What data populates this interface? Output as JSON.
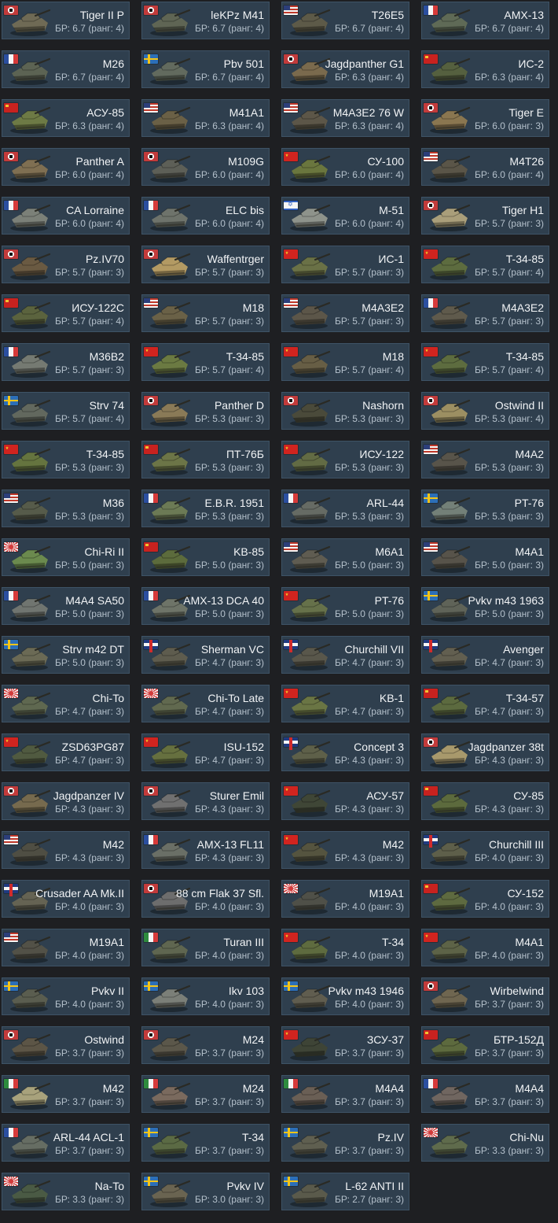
{
  "palette": {
    "background": "#1e1f22",
    "card_bg": "#2f3f4e",
    "name_color": "#f1f3f5",
    "br_color": "#b4c0cb"
  },
  "vehicles": [
    {
      "name": "Tiger II P",
      "br": "БР: 6.7 (ранг: 4)",
      "flag": "de",
      "tank": "#6f6a55"
    },
    {
      "name": "leKPz M41",
      "br": "БР: 6.7 (ранг: 4)",
      "flag": "de",
      "tank": "#5f6554"
    },
    {
      "name": "T26E5",
      "br": "БР: 6.7 (ранг: 4)",
      "flag": "us",
      "tank": "#5d5a48"
    },
    {
      "name": "AMX-13",
      "br": "БР: 6.7 (ранг: 4)",
      "flag": "fr",
      "tank": "#5f6a56"
    },
    {
      "name": "M26",
      "br": "БР: 6.7 (ранг: 4)",
      "flag": "fr",
      "tank": "#5c6353"
    },
    {
      "name": "Pbv 501",
      "br": "БР: 6.7 (ранг: 4)",
      "flag": "se",
      "tank": "#626a5e"
    },
    {
      "name": "Jagdpanther G1",
      "br": "БР: 6.3 (ранг: 4)",
      "flag": "de",
      "tank": "#7a6a4d"
    },
    {
      "name": "ИС-2",
      "br": "БР: 6.3 (ранг: 4)",
      "flag": "su",
      "tank": "#55603f"
    },
    {
      "name": "АСУ-85",
      "br": "БР: 6.3 (ранг: 4)",
      "flag": "su",
      "tank": "#6d7a45"
    },
    {
      "name": "M41A1",
      "br": "БР: 6.3 (ранг: 4)",
      "flag": "us",
      "tank": "#6a6046"
    },
    {
      "name": "M4A3E2 76 W",
      "br": "БР: 6.3 (ранг: 4)",
      "flag": "us",
      "tank": "#5c5648"
    },
    {
      "name": "Tiger E",
      "br": "БР: 6.0 (ранг: 3)",
      "flag": "de",
      "tank": "#8a7650"
    },
    {
      "name": "Panther A",
      "br": "БР: 6.0 (ранг: 4)",
      "flag": "de",
      "tank": "#7f6f52"
    },
    {
      "name": "M109G",
      "br": "БР: 6.0 (ранг: 4)",
      "flag": "de",
      "tank": "#5d5f57"
    },
    {
      "name": "СУ-100",
      "br": "БР: 6.0 (ранг: 4)",
      "flag": "cn",
      "tank": "#6a763e"
    },
    {
      "name": "M4T26",
      "br": "БР: 6.0 (ранг: 4)",
      "flag": "us",
      "tank": "#5a5548"
    },
    {
      "name": "CA Lorraine",
      "br": "БР: 6.0 (ранг: 4)",
      "flag": "fr",
      "tank": "#7b8078"
    },
    {
      "name": "ELC bis",
      "br": "БР: 6.0 (ранг: 4)",
      "flag": "fr",
      "tank": "#6e736b"
    },
    {
      "name": "M-51",
      "br": "БР: 6.0 (ранг: 4)",
      "flag": "il",
      "tank": "#8e938b"
    },
    {
      "name": "Tiger H1",
      "br": "БР: 5.7 (ранг: 3)",
      "flag": "de",
      "tank": "#a99e7a"
    },
    {
      "name": "Pz.IV70",
      "br": "БР: 5.7 (ранг: 3)",
      "flag": "de",
      "tank": "#6a5a42"
    },
    {
      "name": "Waffentrger",
      "br": "БР: 5.7 (ранг: 3)",
      "flag": "de",
      "tank": "#b39a63"
    },
    {
      "name": "ИС-1",
      "br": "БР: 5.7 (ранг: 3)",
      "flag": "cn",
      "tank": "#6a7146"
    },
    {
      "name": "T-34-85",
      "br": "БР: 5.7 (ранг: 4)",
      "flag": "cn",
      "tank": "#5d6c3f"
    },
    {
      "name": "ИСУ-122С",
      "br": "БР: 5.7 (ранг: 4)",
      "flag": "su",
      "tank": "#5b633e"
    },
    {
      "name": "M18",
      "br": "БР: 5.7 (ранг: 3)",
      "flag": "us",
      "tank": "#6a6147"
    },
    {
      "name": "M4A3E2",
      "br": "БР: 5.7 (ранг: 3)",
      "flag": "us",
      "tank": "#5c5649"
    },
    {
      "name": "M4A3E2",
      "br": "БР: 5.7 (ранг: 3)",
      "flag": "fr",
      "tank": "#5f5a4c"
    },
    {
      "name": "M36B2",
      "br": "БР: 5.7 (ранг: 3)",
      "flag": "fr",
      "tank": "#757a72"
    },
    {
      "name": "T-34-85",
      "br": "БР: 5.7 (ранг: 4)",
      "flag": "cn",
      "tank": "#6b7a42"
    },
    {
      "name": "M18",
      "br": "БР: 5.7 (ранг: 4)",
      "flag": "cn",
      "tank": "#675e45"
    },
    {
      "name": "T-34-85",
      "br": "БР: 5.7 (ранг: 4)",
      "flag": "cn",
      "tank": "#5d6c3f"
    },
    {
      "name": "Strv 74",
      "br": "БР: 5.7 (ранг: 4)",
      "flag": "se",
      "tank": "#62685e"
    },
    {
      "name": "Panther D",
      "br": "БР: 5.3 (ранг: 3)",
      "flag": "de",
      "tank": "#8a7a57"
    },
    {
      "name": "Nashorn",
      "br": "БР: 5.3 (ранг: 3)",
      "flag": "de",
      "tank": "#4a4a3a"
    },
    {
      "name": "Ostwind II",
      "br": "БР: 5.3 (ранг: 4)",
      "flag": "de",
      "tank": "#9c8f62"
    },
    {
      "name": "T-34-85",
      "br": "БР: 5.3 (ранг: 3)",
      "flag": "cn",
      "tank": "#65743f"
    },
    {
      "name": "ПТ-76Б",
      "br": "БР: 5.3 (ранг: 3)",
      "flag": "su",
      "tank": "#6c7547"
    },
    {
      "name": "ИСУ-122",
      "br": "БР: 5.3 (ранг: 3)",
      "flag": "cn",
      "tank": "#626b44"
    },
    {
      "name": "M4A2",
      "br": "БР: 5.3 (ранг: 3)",
      "flag": "us",
      "tank": "#58544a"
    },
    {
      "name": "M36",
      "br": "БР: 5.3 (ранг: 3)",
      "flag": "us",
      "tank": "#565b4a"
    },
    {
      "name": "E.B.R. 1951",
      "br": "БР: 5.3 (ранг: 3)",
      "flag": "fr",
      "tank": "#6c7a55"
    },
    {
      "name": "ARL-44",
      "br": "БР: 5.3 (ранг: 3)",
      "flag": "fr",
      "tank": "#666b64"
    },
    {
      "name": "PT-76",
      "br": "БР: 5.3 (ранг: 3)",
      "flag": "se",
      "tank": "#738078"
    },
    {
      "name": "Chi-Ri II",
      "br": "БР: 5.0 (ранг: 3)",
      "flag": "jp",
      "tank": "#6b8a4e"
    },
    {
      "name": "KB-85",
      "br": "БР: 5.0 (ранг: 3)",
      "flag": "su",
      "tank": "#5c6b3c"
    },
    {
      "name": "M6A1",
      "br": "БР: 5.0 (ранг: 3)",
      "flag": "us",
      "tank": "#5f5c51"
    },
    {
      "name": "M4A1",
      "br": "БР: 5.0 (ранг: 3)",
      "flag": "us",
      "tank": "#57534a"
    },
    {
      "name": "M4A4 SA50",
      "br": "БР: 5.0 (ранг: 3)",
      "flag": "fr",
      "tank": "#707570"
    },
    {
      "name": "AMX-13 DCA 40",
      "br": "БР: 5.0 (ранг: 3)",
      "flag": "fr",
      "tank": "#6e7468"
    },
    {
      "name": "PT-76",
      "br": "БР: 5.0 (ранг: 3)",
      "flag": "cn",
      "tank": "#66714a"
    },
    {
      "name": "Pvkv m43 1963",
      "br": "БР: 5.0 (ранг: 3)",
      "flag": "se",
      "tank": "#5f6358"
    },
    {
      "name": "Strv m42 DT",
      "br": "БР: 5.0 (ранг: 3)",
      "flag": "se",
      "tank": "#6b6a55"
    },
    {
      "name": "Sherman VC",
      "br": "БР: 4.7 (ранг: 3)",
      "flag": "gb",
      "tank": "#5e5c4e"
    },
    {
      "name": "Churchill VII",
      "br": "БР: 4.7 (ранг: 3)",
      "flag": "gb",
      "tank": "#59574b"
    },
    {
      "name": "Avenger",
      "br": "БР: 4.7 (ранг: 3)",
      "flag": "gb",
      "tank": "#625f50"
    },
    {
      "name": "Chi-To",
      "br": "БР: 4.7 (ранг: 3)",
      "flag": "jp",
      "tank": "#5f6850"
    },
    {
      "name": "Chi-To Late",
      "br": "БР: 4.7 (ранг: 3)",
      "flag": "jp",
      "tank": "#61694f"
    },
    {
      "name": "KB-1",
      "br": "БР: 4.7 (ранг: 3)",
      "flag": "cn",
      "tank": "#6a7544"
    },
    {
      "name": "T-34-57",
      "br": "БР: 4.7 (ранг: 3)",
      "flag": "su",
      "tank": "#5c6a3f"
    },
    {
      "name": "ZSD63PG87",
      "br": "БР: 4.7 (ранг: 3)",
      "flag": "cn",
      "tank": "#505a40"
    },
    {
      "name": "ISU-152",
      "br": "БР: 4.7 (ранг: 3)",
      "flag": "cn",
      "tank": "#66703f"
    },
    {
      "name": "Concept 3",
      "br": "БР: 4.3 (ранг: 3)",
      "flag": "gb",
      "tank": "#5e6049"
    },
    {
      "name": "Jagdpanzer 38t",
      "br": "БР: 4.3 (ранг: 3)",
      "flag": "de",
      "tank": "#a8996c"
    },
    {
      "name": "Jagdpanzer IV",
      "br": "БР: 4.3 (ранг: 3)",
      "flag": "de",
      "tank": "#766a4e"
    },
    {
      "name": "Sturer Emil",
      "br": "БР: 4.3 (ранг: 3)",
      "flag": "de",
      "tank": "#707070"
    },
    {
      "name": "АСУ-57",
      "br": "БР: 4.3 (ранг: 3)",
      "flag": "cn",
      "tank": "#3f4636"
    },
    {
      "name": "СУ-85",
      "br": "БР: 4.3 (ранг: 3)",
      "flag": "su",
      "tank": "#5c6a3d"
    },
    {
      "name": "M42",
      "br": "БР: 4.3 (ранг: 3)",
      "flag": "us",
      "tank": "#4f4e43"
    },
    {
      "name": "AMX-13 FL11",
      "br": "БР: 4.3 (ранг: 3)",
      "flag": "fr",
      "tank": "#6a6f66"
    },
    {
      "name": "M42",
      "br": "БР: 4.3 (ранг: 3)",
      "flag": "cn",
      "tank": "#55543f"
    },
    {
      "name": "Churchill III",
      "br": "БР: 4.0 (ранг: 3)",
      "flag": "gb",
      "tank": "#5e5f4a"
    },
    {
      "name": "Crusader AA Mk.II",
      "br": "БР: 4.0 (ранг: 3)",
      "flag": "gb",
      "tank": "#656353"
    },
    {
      "name": "88 cm Flak 37 Sfl.",
      "br": "БР: 4.0 (ранг: 3)",
      "flag": "de",
      "tank": "#6d6d6d"
    },
    {
      "name": "M19A1",
      "br": "БР: 4.0 (ранг: 3)",
      "flag": "jp",
      "tank": "#4f5048"
    },
    {
      "name": "СУ-152",
      "br": "БР: 4.0 (ранг: 3)",
      "flag": "su",
      "tank": "#5e6a40"
    },
    {
      "name": "M19A1",
      "br": "БР: 4.0 (ранг: 3)",
      "flag": "us",
      "tank": "#525147"
    },
    {
      "name": "Turan III",
      "br": "БР: 4.0 (ранг: 3)",
      "flag": "it",
      "tank": "#5f6650"
    },
    {
      "name": "T-34",
      "br": "БР: 4.0 (ранг: 3)",
      "flag": "cn",
      "tank": "#5e6b3f"
    },
    {
      "name": "M4A1",
      "br": "БР: 4.0 (ранг: 3)",
      "flag": "cn",
      "tank": "#5d6347"
    },
    {
      "name": "Pvkv II",
      "br": "БР: 4.0 (ранг: 3)",
      "flag": "se",
      "tank": "#5a5d4f"
    },
    {
      "name": "Ikv 103",
      "br": "БР: 4.0 (ранг: 3)",
      "flag": "se",
      "tank": "#7b7f78"
    },
    {
      "name": "Pvkv m43 1946",
      "br": "БР: 4.0 (ранг: 3)",
      "flag": "se",
      "tank": "#605d4f"
    },
    {
      "name": "Wirbelwind",
      "br": "БР: 3.7 (ранг: 3)",
      "flag": "de",
      "tank": "#6f6650"
    },
    {
      "name": "Ostwind",
      "br": "БР: 3.7 (ранг: 3)",
      "flag": "de",
      "tank": "#5c5546"
    },
    {
      "name": "M24",
      "br": "БР: 3.7 (ранг: 3)",
      "flag": "de",
      "tank": "#5b574a"
    },
    {
      "name": "ЗСУ-37",
      "br": "БР: 3.7 (ранг: 3)",
      "flag": "cn",
      "tank": "#3e4436"
    },
    {
      "name": "БТР-152Д",
      "br": "БР: 3.7 (ранг: 3)",
      "flag": "su",
      "tank": "#5d6a3e"
    },
    {
      "name": "M42",
      "br": "БР: 3.7 (ранг: 3)",
      "flag": "it",
      "tank": "#a8a27c"
    },
    {
      "name": "M24",
      "br": "БР: 3.7 (ранг: 3)",
      "flag": "it",
      "tank": "#7a6a5e"
    },
    {
      "name": "M4A4",
      "br": "БР: 3.7 (ранг: 3)",
      "flag": "it",
      "tank": "#6a5f55"
    },
    {
      "name": "M4A4",
      "br": "БР: 3.7 (ранг: 3)",
      "flag": "fr",
      "tank": "#706660"
    },
    {
      "name": "ARL-44 ACL-1",
      "br": "БР: 3.7 (ранг: 3)",
      "flag": "fr",
      "tank": "#666d63"
    },
    {
      "name": "T-34",
      "br": "БР: 3.7 (ранг: 3)",
      "flag": "se",
      "tank": "#5b6a44"
    },
    {
      "name": "Pz.IV",
      "br": "БР: 3.7 (ранг: 3)",
      "flag": "se",
      "tank": "#5f5f50"
    },
    {
      "name": "Chi-Nu",
      "br": "БР: 3.3 (ранг: 3)",
      "flag": "jp",
      "tank": "#5f6b4c"
    },
    {
      "name": "Na-To",
      "br": "БР: 3.3 (ранг: 3)",
      "flag": "jp",
      "tank": "#4a5a44"
    },
    {
      "name": "Pvkv IV",
      "br": "БР: 3.0 (ранг: 3)",
      "flag": "se",
      "tank": "#6a6451"
    },
    {
      "name": "L-62 ANTI II",
      "br": "БР: 2.7 (ранг: 3)",
      "flag": "se",
      "tank": "#5a5a4b"
    }
  ]
}
